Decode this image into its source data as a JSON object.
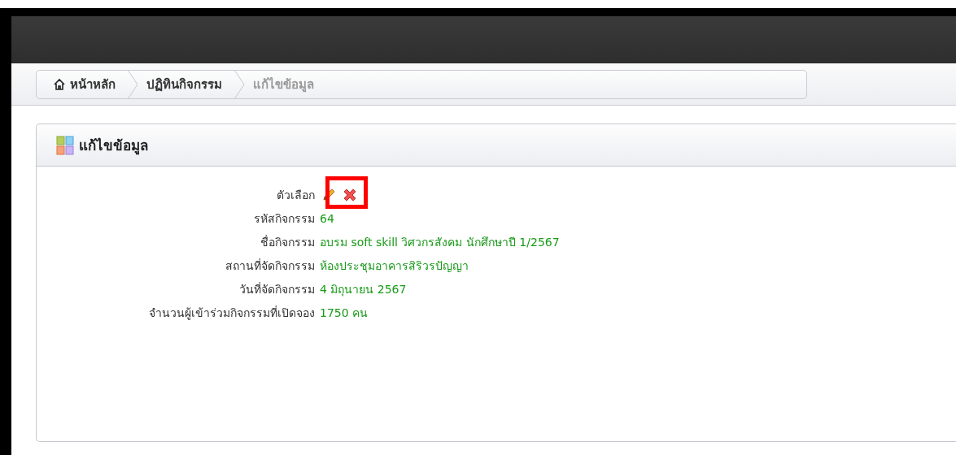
{
  "breadcrumb": [
    {
      "label": "หน้าหลัก",
      "kind": "home",
      "current": false
    },
    {
      "label": "ปฏิทินกิจกรรม",
      "kind": "link",
      "current": false
    },
    {
      "label": "แก้ไขข้อมูล",
      "kind": "link",
      "current": true
    }
  ],
  "panel": {
    "title": "แก้ไขข้อมูล"
  },
  "fields": [
    {
      "label": "ตัวเลือก",
      "kind": "actions",
      "actions": [
        {
          "kind": "edit",
          "highlighted": false
        },
        {
          "kind": "delete",
          "highlighted": true
        }
      ]
    },
    {
      "label": "รหัสกิจกรรม",
      "kind": "text",
      "value": "64"
    },
    {
      "label": "ชื่อกิจกรรม",
      "kind": "text",
      "value": "อบรม soft skill วิศวกรสังคม นักศึกษาปี 1/2567"
    },
    {
      "label": "สถานที่จัดกิจกรรม",
      "kind": "text",
      "value": "ห้องประชุมอาคารสิริวรปัญญา"
    },
    {
      "label": "วันที่จัดกิจกรรม",
      "kind": "text",
      "value": "4 มิถุนายน 2567"
    },
    {
      "label": "จำนวนผู้เข้าร่วมกิจกรรมที่เปิดจอง",
      "kind": "text",
      "value": "1750 คน"
    }
  ]
}
